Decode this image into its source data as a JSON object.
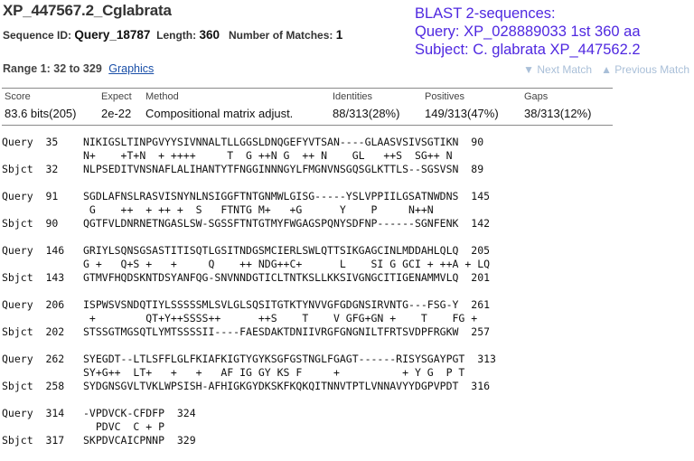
{
  "header": {
    "title": "XP_447567.2_Cglabrata",
    "seq_id_label": "Sequence ID:",
    "seq_id": "Query_18787",
    "length_label": "Length:",
    "length": "360",
    "matches_label": "Number of Matches:",
    "matches": "1"
  },
  "note": {
    "line1": "BLAST 2-sequences:",
    "line2": "Query: XP_028889033 1st 360 aa",
    "line3": "Subject: C. glabrata XP_447562.2"
  },
  "range": {
    "label": "Range 1: 32 to 329",
    "graphics_link": "Graphics",
    "next_match": "▼ Next Match",
    "prev_match": "▲ Previous Match"
  },
  "stats": {
    "headers": [
      "Score",
      "Expect",
      "Method",
      "Identities",
      "Positives",
      "Gaps"
    ],
    "values": [
      "83.6 bits(205)",
      "2e-22",
      "Compositional matrix adjust.",
      "88/313(28%)",
      "149/313(47%)",
      "38/313(12%)"
    ]
  },
  "alignment": {
    "blocks": [
      {
        "query": "Query  35    NIKIGSLTINPGVYYSIVNNALTLLGGSLDNQGEFYVTSAN----GLAASVSIVSGTIKN  90",
        "mid": "             N+    +T+N  + ++++     T  G ++N G  ++ N    GL   ++S  SG++ N",
        "sbjct": "Sbjct  32    NLPSEDITVNSNAFLALIHANTYTFNGGINNNGYLFMGNVNSGQSGLKTTLS--SGSVSN  89"
      },
      {
        "query": "Query  91    SGDLAFNSLRASVISNYNLNSIGGFTNTGNMWLGISG-----YSLVPPIILGSATNWDNS  145",
        "mid": "              G    ++  + ++ +  S   FTNTG M+   +G      Y    P     N++N",
        "sbjct": "Sbjct  90    QGTFVLDNRNETNGASLSW-SGSSFTNTGTMYFWGAGSPQNYSDFNP------SGNFENK  142"
      },
      {
        "query": "Query  146   GRIYLSQNSGSASTITISQTLGSITNDGSMCIERLSWLQTTSIKGAGCINLMDDAHLQLQ  205",
        "mid": "             G +   Q+S +   +     Q    ++ NDG++C+      L    SI G GCI + ++A + LQ",
        "sbjct": "Sbjct  143   GTMVFHQDSKNTDSYANFQG-SNVNNDGTICLTNTKSLLKKSIVGNGCITIGENAMMVLQ  201"
      },
      {
        "query": "Query  206   ISPWSVSNDQTIYLSSSSSMLSVLGLSQSITGTKTYNVVGFGDGNSIRVNTG---FSG-Y  261",
        "mid": "              +        QT+Y++SSSS++      ++S    T    V GFG+GN +    T    FG +",
        "sbjct": "Sbjct  202   STSSGTMGSQTLYMTSSSSII----FAESDAKTDNIIVRGFGNGNILTFRTSVDPFRGKW  257"
      },
      {
        "query": "Query  262   SYEGDT--LTLSFFLGLFKIAFKIGTYGYKSGFGSTNGLFGAGT------RISYSGAYPGT  313",
        "mid": "             SY+G++  LT+   +   +   AF IG GY KS F     +          + Y G  P T",
        "sbjct": "Sbjct  258   SYDGNSGVLTVKLWPSISH-AFHIGKGYDKSKFKQKQITNNVTPTLVNNAVYYDGPVPDT  316"
      },
      {
        "query": "Query  314   -VPDVCK-CFDFP  324",
        "mid": "               PDVC  C + P",
        "sbjct": "Sbjct  317   SKPDVCAICPNNP  329"
      }
    ]
  }
}
